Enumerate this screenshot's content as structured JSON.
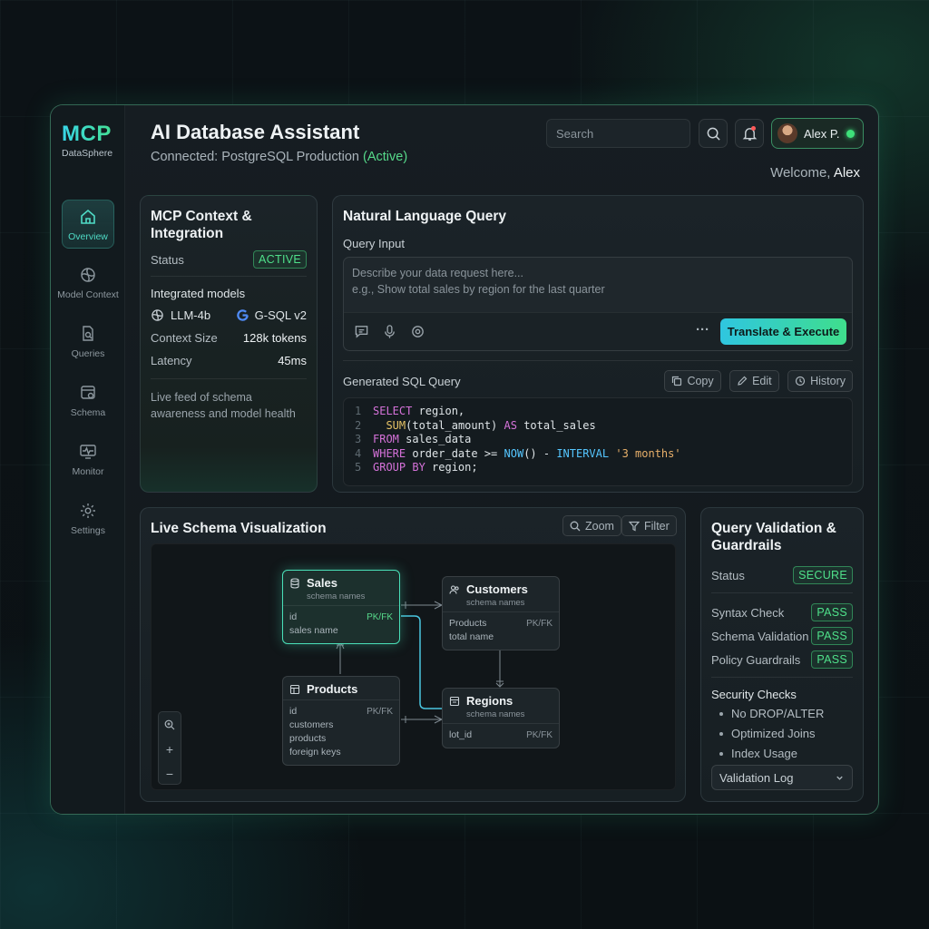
{
  "brand": {
    "logo": "MCP",
    "name": "DataSphere"
  },
  "sidebar": {
    "items": [
      {
        "label": "Overview",
        "icon": "home-icon",
        "active": true
      },
      {
        "label": "Model Context",
        "icon": "model-icon"
      },
      {
        "label": "Queries",
        "icon": "queries-icon"
      },
      {
        "label": "Schema",
        "icon": "schema-icon"
      },
      {
        "label": "Monitor",
        "icon": "monitor-icon"
      },
      {
        "label": "Settings",
        "icon": "gear-icon"
      }
    ]
  },
  "header": {
    "title": "AI Database Assistant",
    "connection_prefix": "Connected: PostgreSQL Production ",
    "connection_status": "(Active)",
    "search_placeholder": "Search",
    "user_name": "Alex P.",
    "welcome_prefix": "Welcome, ",
    "welcome_name": "Alex"
  },
  "mcp": {
    "title": "MCP Context & Integration",
    "status_label": "Status",
    "status_value": "ACTIVE",
    "models_label": "Integrated models",
    "model_1": "LLM-4b",
    "model_2": "G-SQL v2",
    "context_label": "Context Size",
    "context_value": "128k tokens",
    "latency_label": "Latency",
    "latency_value": "45ms",
    "note": "Live feed of schema awareness and model health"
  },
  "nlq": {
    "title": "Natural Language Query",
    "input_label": "Query Input",
    "placeholder_1": "Describe your data request here...",
    "placeholder_2": "e.g., Show total sales by region for the last quarter",
    "execute_label": "Translate & Execute",
    "more_label": "···",
    "sql_label": "Generated SQL Query",
    "copy_label": "Copy",
    "edit_label": "Edit",
    "history_label": "History",
    "sql_lines": [
      "SELECT region,",
      "  SUM(total_amount) AS total_sales",
      "FROM sales_data",
      "WHERE order_date >= NOW() - INTERVAL '3 months'",
      "GROUP BY region;"
    ]
  },
  "schema": {
    "title": "Live Schema Visualization",
    "zoom_label": "Zoom",
    "filter_label": "Filter",
    "subtitle": "schema names",
    "tables": {
      "sales": {
        "name": "Sales",
        "rows": [
          {
            "k": "id",
            "v": "PK/FK"
          },
          {
            "k": "sales name",
            "v": ""
          }
        ]
      },
      "customers": {
        "name": "Customers",
        "rows": [
          {
            "k": "Products",
            "v": "PK/FK"
          },
          {
            "k": "total name",
            "v": ""
          }
        ]
      },
      "products": {
        "name": "Products",
        "rows": [
          {
            "k": "id",
            "v": "PK/FK"
          },
          {
            "k": "customers",
            "v": ""
          },
          {
            "k": "products",
            "v": ""
          },
          {
            "k": "foreign keys",
            "v": ""
          }
        ]
      },
      "regions": {
        "name": "Regions",
        "rows": [
          {
            "k": "lot_id",
            "v": "PK/FK"
          }
        ]
      }
    }
  },
  "validation": {
    "title": "Query Validation & Guardrails",
    "status_label": "Status",
    "status_value": "SECURE",
    "checks": [
      {
        "label": "Syntax Check",
        "value": "PASS"
      },
      {
        "label": "Schema Validation",
        "value": "PASS"
      },
      {
        "label": "Policy Guardrails",
        "value": "PASS"
      }
    ],
    "security_label": "Security Checks",
    "security_items": [
      "No DROP/ALTER",
      "Optimized Joins",
      "Index Usage"
    ],
    "log_label": "Validation Log"
  },
  "colors": {
    "accent_green": "#4fe08a",
    "accent_cyan": "#38d6e8",
    "highlight": "#4ae0b8"
  }
}
